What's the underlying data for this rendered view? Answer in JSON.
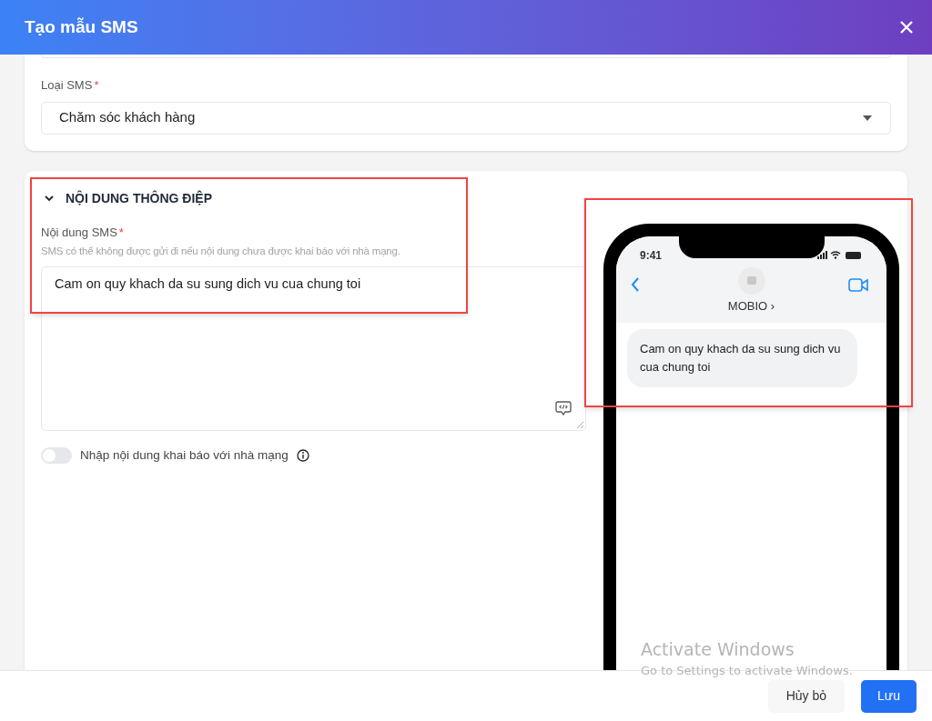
{
  "dialog": {
    "title": "Tạo mẫu SMS"
  },
  "sms_type": {
    "label": "Loại SMS",
    "required_mark": "*",
    "value": "Chăm sóc khách hàng"
  },
  "section": {
    "title": "NỘI DUNG THÔNG ĐIỆP",
    "expanded": true,
    "content_field": {
      "label": "Nội dung SMS",
      "required_mark": "*",
      "hint": "SMS có thể không được gửi đi nếu nội dung chưa được khai báo với nhà mạng.",
      "value": "Cam on quy khach da su sung dich vu cua chung toi"
    },
    "toggle": {
      "label": "Nhập nội dung khai báo với nhà mạng",
      "on": false
    }
  },
  "preview": {
    "time": "9:41",
    "sender": "MOBIO ›",
    "message": "Cam on quy khach da su sung dich vu cua chung toi"
  },
  "os_notice": {
    "title": "Activate Windows",
    "text": "Go to Settings to activate Windows."
  },
  "buttons": [
    {
      "label": "Hủy bỏ",
      "kind": "secondary"
    },
    {
      "label": "Lưu",
      "kind": "primary"
    }
  ]
}
